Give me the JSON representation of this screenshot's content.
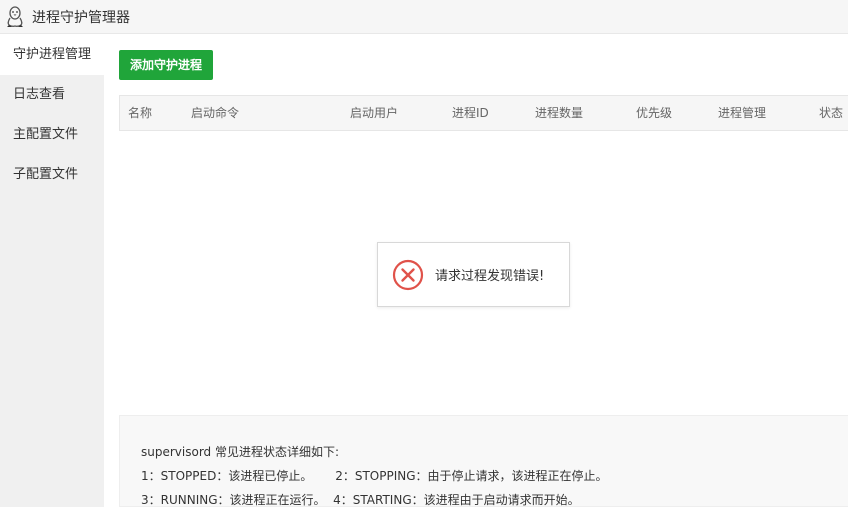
{
  "app": {
    "title": "进程守护管理器"
  },
  "sidebar": {
    "items": [
      {
        "label": "守护进程管理",
        "active": true
      },
      {
        "label": "日志查看",
        "active": false
      },
      {
        "label": "主配置文件",
        "active": false
      },
      {
        "label": "子配置文件",
        "active": false
      }
    ]
  },
  "toolbar": {
    "add_label": "添加守护进程"
  },
  "table": {
    "columns": [
      "名称",
      "启动命令",
      "启动用户",
      "进程ID",
      "进程数量",
      "优先级",
      "进程管理",
      "状态"
    ]
  },
  "error": {
    "message": "请求过程发现错误!"
  },
  "info": {
    "heading": "supervisord 常见进程状态详细如下:",
    "line1": "1：STOPPED：该进程已停止。      2：STOPPING：由于停止请求，该进程正在停止。",
    "line2": "3：RUNNING：该进程正在运行。  4：STARTING：该进程由于启动请求而开始。"
  },
  "colors": {
    "primary": "#20a53a",
    "error": "#e0524a"
  }
}
